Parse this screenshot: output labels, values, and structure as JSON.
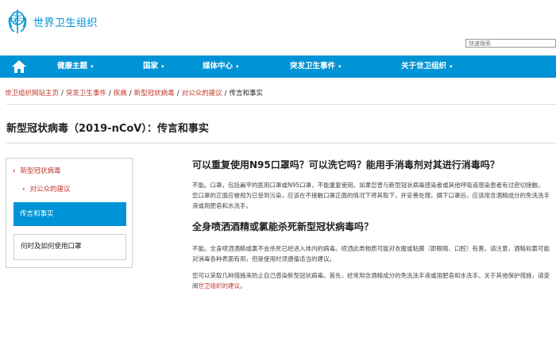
{
  "logo": {
    "text": "世界卫生组织"
  },
  "search": {
    "placeholder": "快速搜索"
  },
  "nav": {
    "items": [
      "健康主题",
      "国家",
      "媒体中心",
      "突发卫生事件",
      "关于世卫组织"
    ],
    "caret": "▾"
  },
  "breadcrumb": {
    "items": [
      "世卫组织网站主页",
      "突发卫生事件",
      "疾病",
      "新型冠状病毒",
      "对公众的建议"
    ],
    "current": "传言和事实",
    "separator": "/"
  },
  "page_title": "新型冠状病毒（2019-nCoV）：传言和事实",
  "sidebar": {
    "parent": "新型冠状病毒",
    "child": "对公众的建议",
    "active": "传言和事实",
    "next": "何时及如何使用口罩",
    "chevron": "‹"
  },
  "content": {
    "q1": "可以重复使用N95口罩吗？可以洗它吗？能用手消毒剂对其进行消毒吗？",
    "a1": "不能。口罩，包括扁平的医用口罩或N95口罩，不能重复使用。如果您曾与新型冠状病毒感染者或其他呼吸道感染患者有过密切接触，您口罩的正面应被视为已受到污染，应该在不接触口罩正面的情况下将其取下，并妥善处理。摘下口罩后，应该用含酒精成分的免洗洗手液或用肥皂和水洗手。",
    "q2": "全身喷洒酒精或氯能杀死新型冠状病毒吗？",
    "a2": "不能。全身喷洒酒精或氯不会杀死已经进入体内的病毒。喷洒此类物质可能对衣服或粘膜（即眼睛、口腔）有害。请注意，酒精和氯可能对消毒各种表面有用，但是使用时须遵循适当的建议。",
    "a3_text": "您可以采取几种措施来防止自己感染新型冠状病毒。首先，经常用含酒精成分的免洗洗手液或用肥皂和水洗手。关于其他保护措施，请查阅",
    "a3_link": "世卫组织的建议",
    "a3_end": "。"
  },
  "colors": {
    "brand_blue": "#0093d5",
    "link_red": "#c0392b"
  },
  "icons": {
    "home": "home-icon",
    "logo": "who-emblem-icon"
  }
}
